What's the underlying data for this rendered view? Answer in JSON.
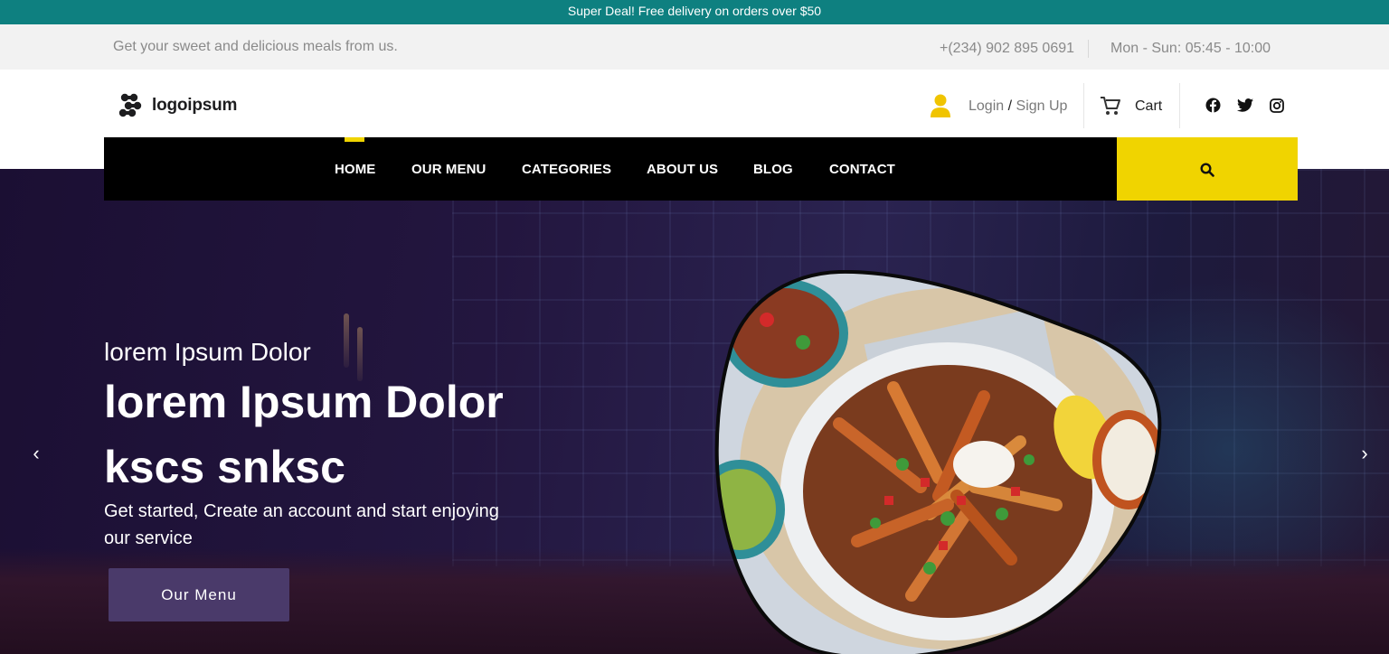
{
  "promo": {
    "text": "Super Deal! Free delivery on orders over $50"
  },
  "infobar": {
    "tagline": "Get your sweet and delicious meals from us.",
    "phone": "+(234) 902 895 0691",
    "hours": "Mon - Sun: 05:45 - 10:00"
  },
  "header": {
    "logo_text": "logoipsum",
    "login": "Login",
    "slash": "/",
    "signup": "Sign Up",
    "cart": "Cart",
    "social_icons": [
      "facebook-icon",
      "twitter-icon",
      "instagram-icon"
    ]
  },
  "nav": {
    "items": [
      {
        "label": "HOME",
        "active": true
      },
      {
        "label": "OUR MENU"
      },
      {
        "label": "CATEGORIES"
      },
      {
        "label": "ABOUT US"
      },
      {
        "label": "BLOG"
      },
      {
        "label": "CONTACT"
      }
    ],
    "search_icon": "search-icon"
  },
  "hero": {
    "subtitle": "lorem Ipsum Dolor",
    "title": "lorem Ipsum Dolor kscs snksc",
    "description": "Get started, Create an account and start enjoying our service",
    "button": "Our Menu",
    "prev_icon": "‹",
    "next_icon": "›"
  },
  "colors": {
    "promo_bg": "#0e8080",
    "accent_yellow": "#f0d400",
    "nav_bg": "#000000",
    "button_bg": "#4a3a6a",
    "hero_bg": "#23163f"
  }
}
